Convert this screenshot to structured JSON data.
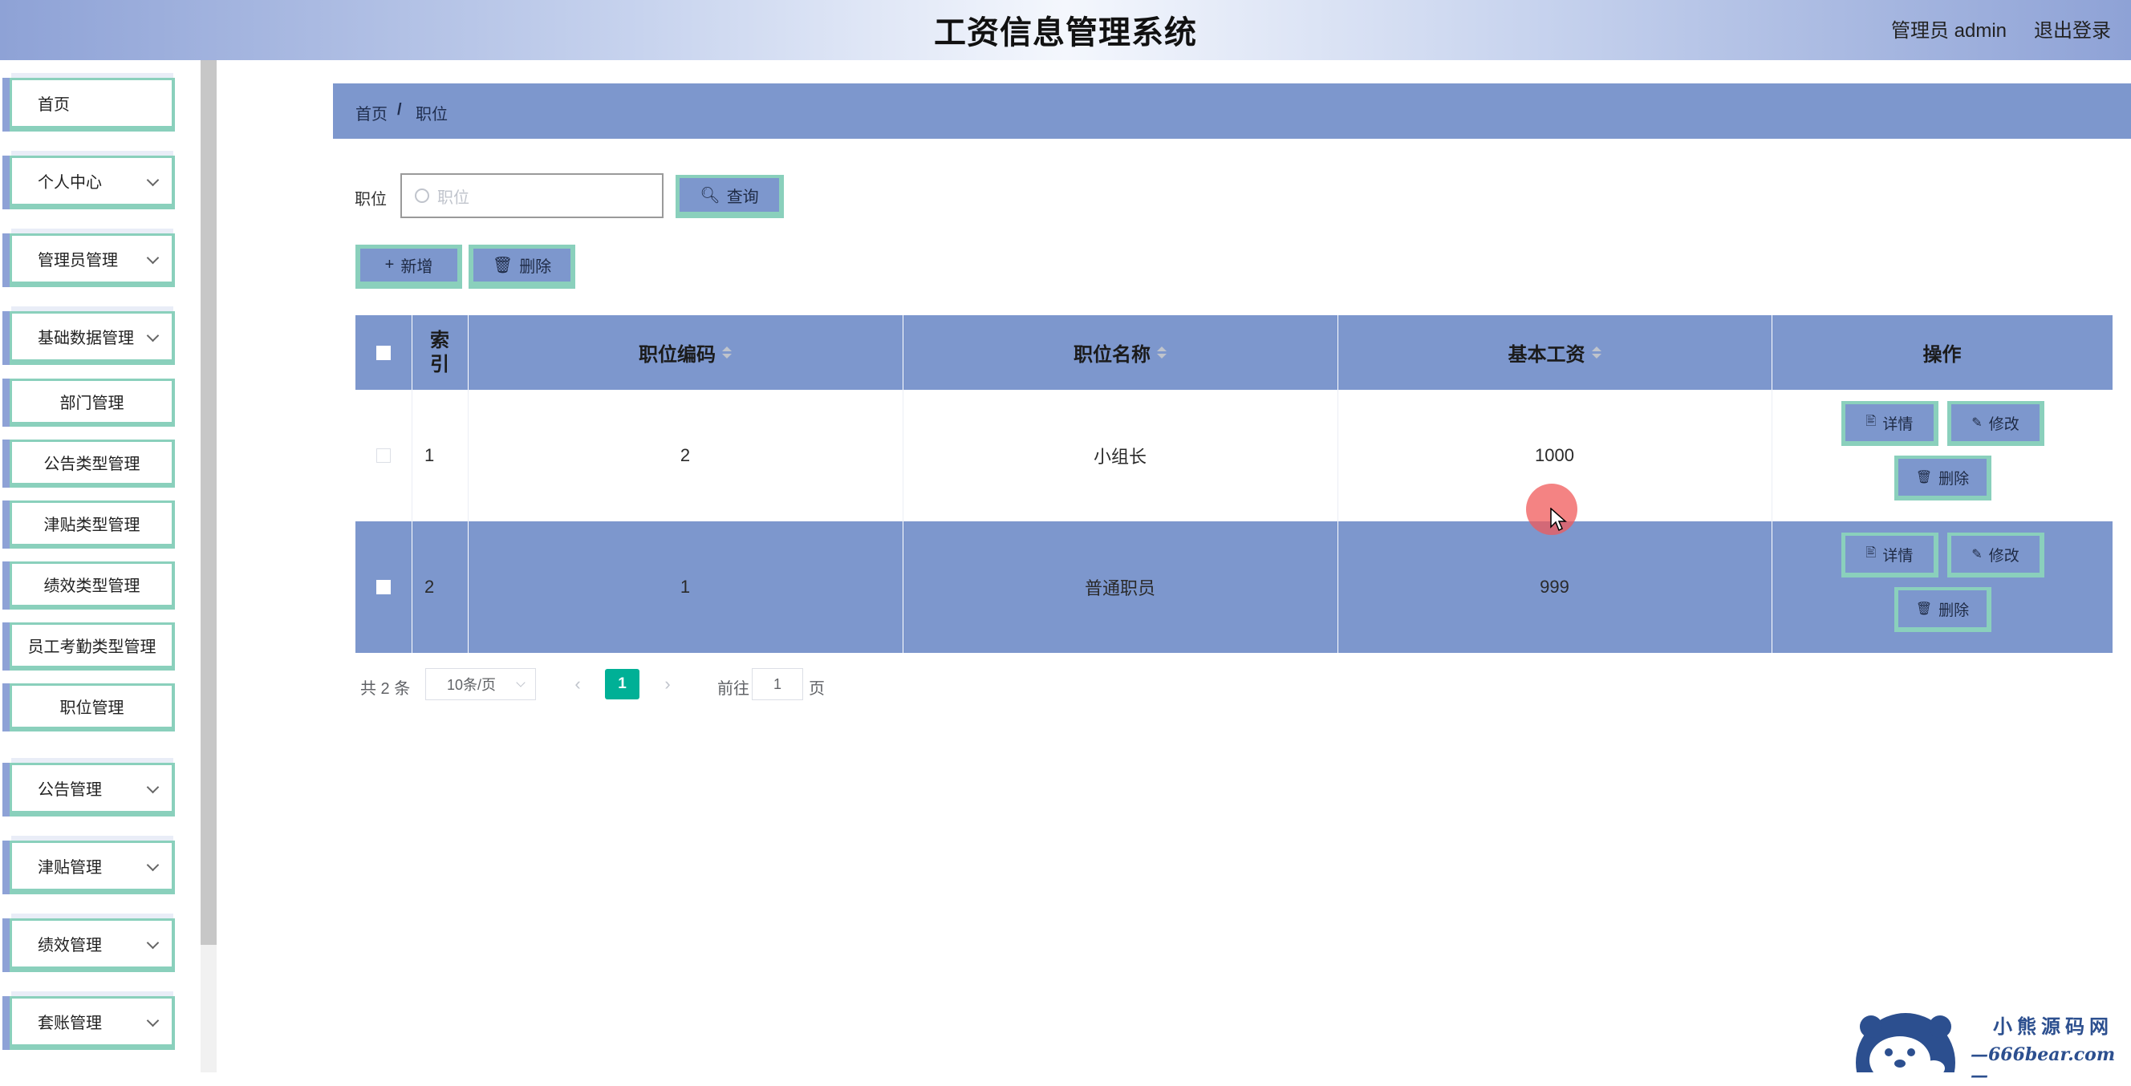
{
  "app": {
    "title": "工资信息管理系统",
    "user": "管理员 admin",
    "logout": "退出登录"
  },
  "sidebar": {
    "items": [
      {
        "label": "首页",
        "expandable": false
      },
      {
        "label": "个人中心",
        "expandable": true
      },
      {
        "label": "管理员管理",
        "expandable": true
      },
      {
        "label": "基础数据管理",
        "expandable": true,
        "expanded": true,
        "children": [
          "部门管理",
          "公告类型管理",
          "津贴类型管理",
          "绩效类型管理",
          "员工考勤类型管理",
          "职位管理"
        ]
      },
      {
        "label": "公告管理",
        "expandable": true
      },
      {
        "label": "津贴管理",
        "expandable": true
      },
      {
        "label": "绩效管理",
        "expandable": true
      },
      {
        "label": "套账管理",
        "expandable": true
      }
    ]
  },
  "breadcrumb": {
    "home": "首页",
    "sep": "/",
    "current": "职位"
  },
  "search": {
    "label": "职位",
    "placeholder": "职位",
    "button": "查询"
  },
  "toolbar": {
    "add": "新增",
    "delete": "删除"
  },
  "table": {
    "headers": {
      "index": "索引",
      "code": "职位编码",
      "name": "职位名称",
      "salary": "基本工资",
      "ops": "操作"
    },
    "rows": [
      {
        "index": "1",
        "code": "2",
        "name": "小组长",
        "salary": "1000"
      },
      {
        "index": "2",
        "code": "1",
        "name": "普通职员",
        "salary": "999"
      }
    ],
    "actions": {
      "detail": "详情",
      "edit": "修改",
      "delete": "删除"
    }
  },
  "pagination": {
    "total": "共 2 条",
    "page_size": "10条/页",
    "current_page": "1",
    "goto_label": "前往",
    "goto_value": "1",
    "page_suffix": "页"
  },
  "watermark": {
    "line1": "小熊源码网",
    "line2": "—666bear.com—"
  },
  "colors": {
    "accent": "#7d97cd",
    "border_accent": "#8ad0bc",
    "pagination_active": "#00b096"
  }
}
